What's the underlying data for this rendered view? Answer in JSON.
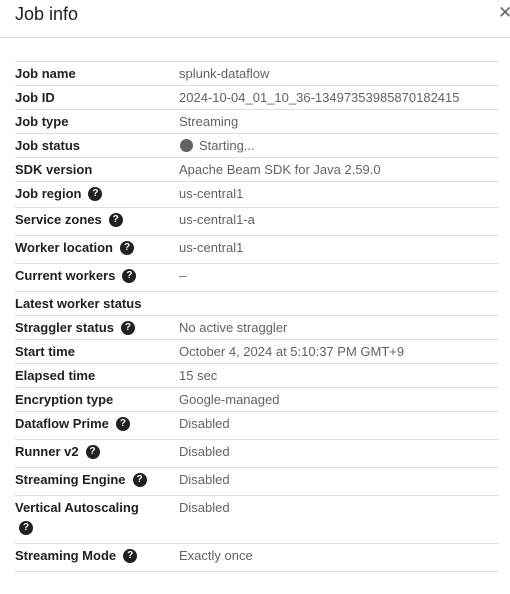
{
  "panel": {
    "title": "Job info",
    "close_icon": "close-icon"
  },
  "help_glyph": "?",
  "rows": [
    {
      "key": "job-name",
      "label": "Job name",
      "value": "splunk-dataflow",
      "help": false
    },
    {
      "key": "job-id",
      "label": "Job ID",
      "value": "2024-10-04_01_10_36-13497353985870182415",
      "help": false
    },
    {
      "key": "job-type",
      "label": "Job type",
      "value": "Streaming",
      "help": false
    },
    {
      "key": "job-status",
      "label": "Job status",
      "value": "Starting...",
      "help": false,
      "status_icon": "status-dot-icon",
      "status_color": "#5f6368"
    },
    {
      "key": "sdk-version",
      "label": "SDK version",
      "value": "Apache Beam SDK for Java 2.59.0",
      "help": false
    },
    {
      "key": "job-region",
      "label": "Job region",
      "value": "us-central1",
      "help": true
    },
    {
      "key": "service-zones",
      "label": "Service zones",
      "value": "us-central1-a",
      "help": true
    },
    {
      "key": "worker-location",
      "label": "Worker location",
      "value": "us-central1",
      "help": true
    },
    {
      "key": "current-workers",
      "label": "Current workers",
      "value": "–",
      "help": true
    },
    {
      "key": "latest-worker-status",
      "label": "Latest worker status",
      "value": "",
      "help": false
    },
    {
      "key": "straggler-status",
      "label": "Straggler status",
      "value": "No active straggler",
      "help": true
    },
    {
      "key": "start-time",
      "label": "Start time",
      "value": "October 4, 2024 at 5:10:37 PM GMT+9",
      "help": false
    },
    {
      "key": "elapsed-time",
      "label": "Elapsed time",
      "value": "15 sec",
      "help": false
    },
    {
      "key": "encryption-type",
      "label": "Encryption type",
      "value": "Google-managed",
      "help": false
    },
    {
      "key": "dataflow-prime",
      "label": "Dataflow Prime",
      "value": "Disabled",
      "help": true
    },
    {
      "key": "runner-v2",
      "label": "Runner v2",
      "value": "Disabled",
      "help": true
    },
    {
      "key": "streaming-engine",
      "label": "Streaming Engine",
      "value": "Disabled",
      "help": true
    },
    {
      "key": "vertical-autoscaling",
      "label": "Vertical Autoscaling",
      "value": "Disabled",
      "help": true,
      "help_wrapped": true
    },
    {
      "key": "streaming-mode",
      "label": "Streaming Mode",
      "value": "Exactly once",
      "help": true
    }
  ]
}
